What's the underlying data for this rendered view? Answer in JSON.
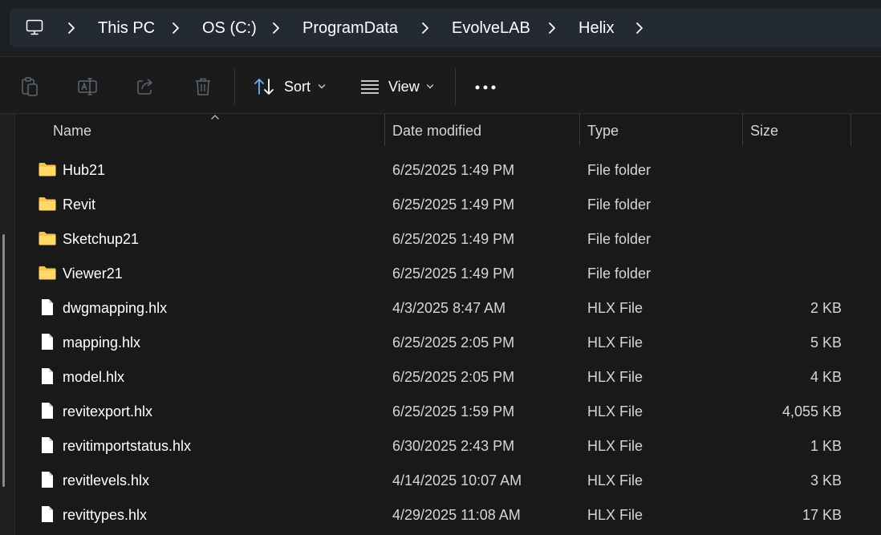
{
  "address_bar": {
    "root_icon": "computer-icon",
    "breadcrumbs": [
      "This PC",
      "OS (C:)",
      "ProgramData",
      "EvolveLAB",
      "Helix"
    ]
  },
  "toolbar": {
    "icons": [
      "paste-icon",
      "rename-icon",
      "share-icon",
      "delete-icon"
    ],
    "sort_label": "Sort",
    "view_label": "View",
    "more_icon": "more-options-icon"
  },
  "columns": {
    "name": "Name",
    "date": "Date modified",
    "type": "Type",
    "size": "Size"
  },
  "files": [
    {
      "name": "Hub21",
      "date": "6/25/2025 1:49 PM",
      "type": "File folder",
      "size": "",
      "icon": "folder-icon"
    },
    {
      "name": "Revit",
      "date": "6/25/2025 1:49 PM",
      "type": "File folder",
      "size": "",
      "icon": "folder-icon"
    },
    {
      "name": "Sketchup21",
      "date": "6/25/2025 1:49 PM",
      "type": "File folder",
      "size": "",
      "icon": "folder-icon"
    },
    {
      "name": "Viewer21",
      "date": "6/25/2025 1:49 PM",
      "type": "File folder",
      "size": "",
      "icon": "folder-icon"
    },
    {
      "name": "dwgmapping.hlx",
      "date": "4/3/2025 8:47 AM",
      "type": "HLX File",
      "size": "2 KB",
      "icon": "file-icon"
    },
    {
      "name": "mapping.hlx",
      "date": "6/25/2025 2:05 PM",
      "type": "HLX File",
      "size": "5 KB",
      "icon": "file-icon"
    },
    {
      "name": "model.hlx",
      "date": "6/25/2025 2:05 PM",
      "type": "HLX File",
      "size": "4 KB",
      "icon": "file-icon"
    },
    {
      "name": "revitexport.hlx",
      "date": "6/25/2025 1:59 PM",
      "type": "HLX File",
      "size": "4,055 KB",
      "icon": "file-icon"
    },
    {
      "name": "revitimportstatus.hlx",
      "date": "6/30/2025 2:43 PM",
      "type": "HLX File",
      "size": "1 KB",
      "icon": "file-icon"
    },
    {
      "name": "revitlevels.hlx",
      "date": "4/14/2025 10:07 AM",
      "type": "HLX File",
      "size": "3 KB",
      "icon": "file-icon"
    },
    {
      "name": "revittypes.hlx",
      "date": "4/29/2025 11:08 AM",
      "type": "HLX File",
      "size": "17 KB",
      "icon": "file-icon"
    }
  ],
  "colors": {
    "background": "#191919",
    "address_bar": "#232a33",
    "folder": "#f4c44e",
    "accent": "#6ab0f3"
  }
}
